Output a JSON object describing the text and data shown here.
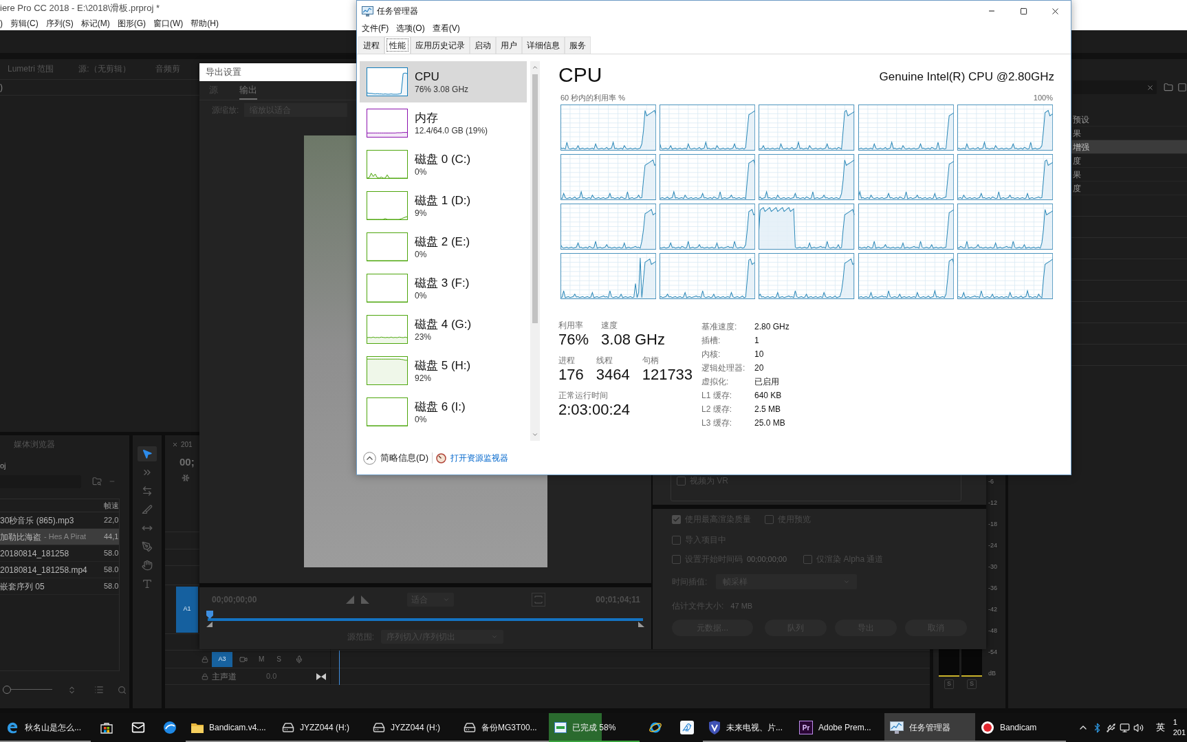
{
  "premiere": {
    "title": "iere Pro CC 2018 - E:\\2018\\滑板.prproj *",
    "menu": [
      ")",
      "剪辑(C)",
      "序列(S)",
      "标记(M)",
      "图形(G)",
      "窗口(W)",
      "帮助(H)"
    ],
    "top_panel": {
      "tabs": [
        {
          "label": "Lumetri 范围",
          "selected": false
        },
        {
          "label": "源:（无剪辑）",
          "selected": false
        },
        {
          "label": "音频剪",
          "selected": false
        }
      ],
      "clip_field": ")"
    },
    "project_panel": {
      "tab": "媒体浏览器",
      "project_name": "oj",
      "column_header": "帧速",
      "rows": [
        {
          "name": "30秒音乐 (865).mp3",
          "rate": "22,0",
          "selected": false
        },
        {
          "name": "加勒比海盗",
          "detail": "- Hes A Pirat",
          "rate": "44,1",
          "selected": true
        },
        {
          "name": "20180814_181258",
          "rate": "58.0",
          "selected": false
        },
        {
          "name": "20180814_181258.mp4",
          "rate": "58.0",
          "selected": false
        },
        {
          "name": "嵌套序列 05",
          "rate": "58.0",
          "selected": false
        }
      ],
      "zoom_slider": {
        "level": 0
      }
    },
    "tools": [
      {
        "kind": "select",
        "selected": true
      },
      {
        "kind": "track",
        "selected": false
      },
      {
        "kind": "ripple",
        "selected": false
      },
      {
        "kind": "razor",
        "selected": false
      },
      {
        "kind": "slip",
        "selected": false
      },
      {
        "kind": "pen",
        "selected": false
      },
      {
        "kind": "hand",
        "selected": false
      },
      {
        "kind": "type",
        "selected": false
      }
    ],
    "timeline": {
      "tab": "201",
      "timecode": "00;",
      "target_track": {
        "label": "A1",
        "on": true
      },
      "audio_track": {
        "target": {
          "label": "A3",
          "on": true
        },
        "mute": "M",
        "solo": "S"
      },
      "master_track": {
        "label": "主声道",
        "volume": "0.0"
      }
    },
    "audio_meter": {
      "scale": [
        "-6",
        "-12",
        "-18",
        "-24",
        "-30",
        "-36",
        "-42",
        "-48",
        "-54",
        "dB"
      ],
      "solo_buttons": [
        "S",
        "S"
      ]
    },
    "effects_panel": {
      "items": [
        {
          "label": "预设",
          "selected": false
        },
        {
          "label": "果",
          "selected": false
        },
        {
          "label": "增强",
          "selected": true
        },
        {
          "label": "度",
          "selected": false
        },
        {
          "label": "果",
          "selected": false
        },
        {
          "label": "度",
          "selected": false
        }
      ]
    }
  },
  "export_dialog": {
    "title": "导出设置",
    "tabs": [
      {
        "label": "源",
        "selected": false
      },
      {
        "label": "输出",
        "selected": true
      }
    ],
    "source_scaling": {
      "label": "源缩放:",
      "value": "缩放以适合"
    },
    "start_time": "00;00;00;00",
    "fit": "适合",
    "end_time": "00;01;04;11",
    "scrubber": {
      "level": 0
    },
    "source_range": {
      "label": "源范围:",
      "value": "序列切入/序列切出"
    },
    "vr": {
      "label": "视频为 VR",
      "checked": false
    },
    "option_rows": [
      {
        "items": [
          {
            "label": "使用最高渲染质量",
            "checked": true
          },
          {
            "label": "使用预览",
            "checked": false
          }
        ]
      },
      {
        "items": [
          {
            "label": "导入项目中",
            "checked": false
          }
        ]
      },
      {
        "items": [
          {
            "label": "设置开始时间码",
            "value": "00;00;00;00",
            "checked": false
          },
          {
            "label": "仅渲染 Alpha 通道",
            "checked": false
          }
        ]
      }
    ],
    "interpolation": {
      "label": "时间插值:",
      "value": "帧采样"
    },
    "file_size": {
      "label": "估计文件大小:",
      "value": "47 MB"
    },
    "buttons": [
      "元数据...",
      "队列",
      "导出",
      "取消"
    ]
  },
  "task_manager": {
    "title": "任务管理器",
    "menu": [
      "文件(F)",
      "选项(O)",
      "查看(V)"
    ],
    "tabs": [
      {
        "label": "进程",
        "selected": false
      },
      {
        "label": "性能",
        "selected": true
      },
      {
        "label": "应用历史记录",
        "selected": false
      },
      {
        "label": "启动",
        "selected": false
      },
      {
        "label": "用户",
        "selected": false
      },
      {
        "label": "详细信息",
        "selected": false
      },
      {
        "label": "服务",
        "selected": false
      }
    ],
    "resources": [
      {
        "kind": "cpu",
        "title": "CPU",
        "subtitle": "76% 3.08 GHz",
        "selected": true
      },
      {
        "kind": "memory",
        "title": "内存",
        "subtitle": "12.4/64.0 GB (19%)",
        "selected": false
      },
      {
        "kind": "disk",
        "title": "磁盘 0 (C:)",
        "subtitle": "0%",
        "selected": false
      },
      {
        "kind": "disk",
        "title": "磁盘 1 (D:)",
        "subtitle": "9%",
        "selected": false
      },
      {
        "kind": "disk",
        "title": "磁盘 2 (E:)",
        "subtitle": "0%",
        "selected": false
      },
      {
        "kind": "disk",
        "title": "磁盘 3 (F:)",
        "subtitle": "0%",
        "selected": false
      },
      {
        "kind": "disk",
        "title": "磁盘 4 (G:)",
        "subtitle": "23%",
        "selected": false
      },
      {
        "kind": "disk",
        "title": "磁盘 5 (H:)",
        "subtitle": "92%",
        "selected": false
      },
      {
        "kind": "disk",
        "title": "磁盘 6 (I:)",
        "subtitle": "0%",
        "selected": false
      }
    ],
    "detail": {
      "title": "CPU",
      "model": "Genuine Intel(R) CPU @2.80GHz",
      "graph_caption": "60 秒内的利用率 %",
      "graph_max": "100%",
      "stat_rows": [
        {
          "items": [
            {
              "label": "利用率",
              "value": "76%"
            },
            {
              "label": "速度",
              "value": "3.08 GHz"
            }
          ]
        },
        {
          "items": [
            {
              "label": "进程",
              "value": "176"
            },
            {
              "label": "线程",
              "value": "3464"
            },
            {
              "label": "句柄",
              "value": "121733"
            }
          ]
        },
        {
          "items": [
            {
              "label": "正常运行时间",
              "value": "2:03:00:24"
            }
          ]
        }
      ],
      "specs": [
        {
          "label": "基准速度:",
          "value": "2.80 GHz"
        },
        {
          "label": "插槽:",
          "value": "1"
        },
        {
          "label": "内核:",
          "value": "10"
        },
        {
          "label": "逻辑处理器:",
          "value": "20"
        },
        {
          "label": "虚拟化:",
          "value": "已启用"
        },
        {
          "label": "L1 缓存:",
          "value": "640 KB"
        },
        {
          "label": "L2 缓存:",
          "value": "2.5 MB"
        },
        {
          "label": "L3 缓存:",
          "value": "25.0 MB"
        }
      ]
    },
    "footer": {
      "collapse": "简略信息(D)",
      "link": "打开资源监视器"
    }
  },
  "taskbar": {
    "items": [
      {
        "kind": "swirl",
        "label": "秋名山是怎么...",
        "selected": false
      },
      {
        "kind": "store",
        "selected": false
      },
      {
        "kind": "mail",
        "selected": false
      },
      {
        "kind": "ball",
        "selected": false
      },
      {
        "kind": "folder",
        "label": "Bandicam.v4....",
        "selected": false
      },
      {
        "kind": "drive",
        "label": "JYZZ044 (H:)",
        "selected": false
      },
      {
        "kind": "drive",
        "label": "JYZZ044 (H:)",
        "selected": false
      },
      {
        "kind": "drive",
        "label": "备份MG3T00...",
        "selected": false
      },
      {
        "kind": "copy",
        "label": "已完成 58%",
        "level": 0.58,
        "selected": false
      },
      {
        "kind": "orbit",
        "selected": false
      },
      {
        "kind": "bird",
        "selected": false
      },
      {
        "kind": "shield",
        "label": "未来电视、片...",
        "selected": false
      },
      {
        "kind": "tile",
        "badge": "Pr",
        "label": "Adobe Prem...",
        "selected": false
      },
      {
        "kind": "monitor",
        "label": "任务管理器",
        "selected": true
      },
      {
        "kind": "record",
        "label": "Bandicam",
        "selected": false
      }
    ],
    "tray": {
      "input_method": "英",
      "clock": [
        "1",
        "201"
      ]
    }
  }
}
